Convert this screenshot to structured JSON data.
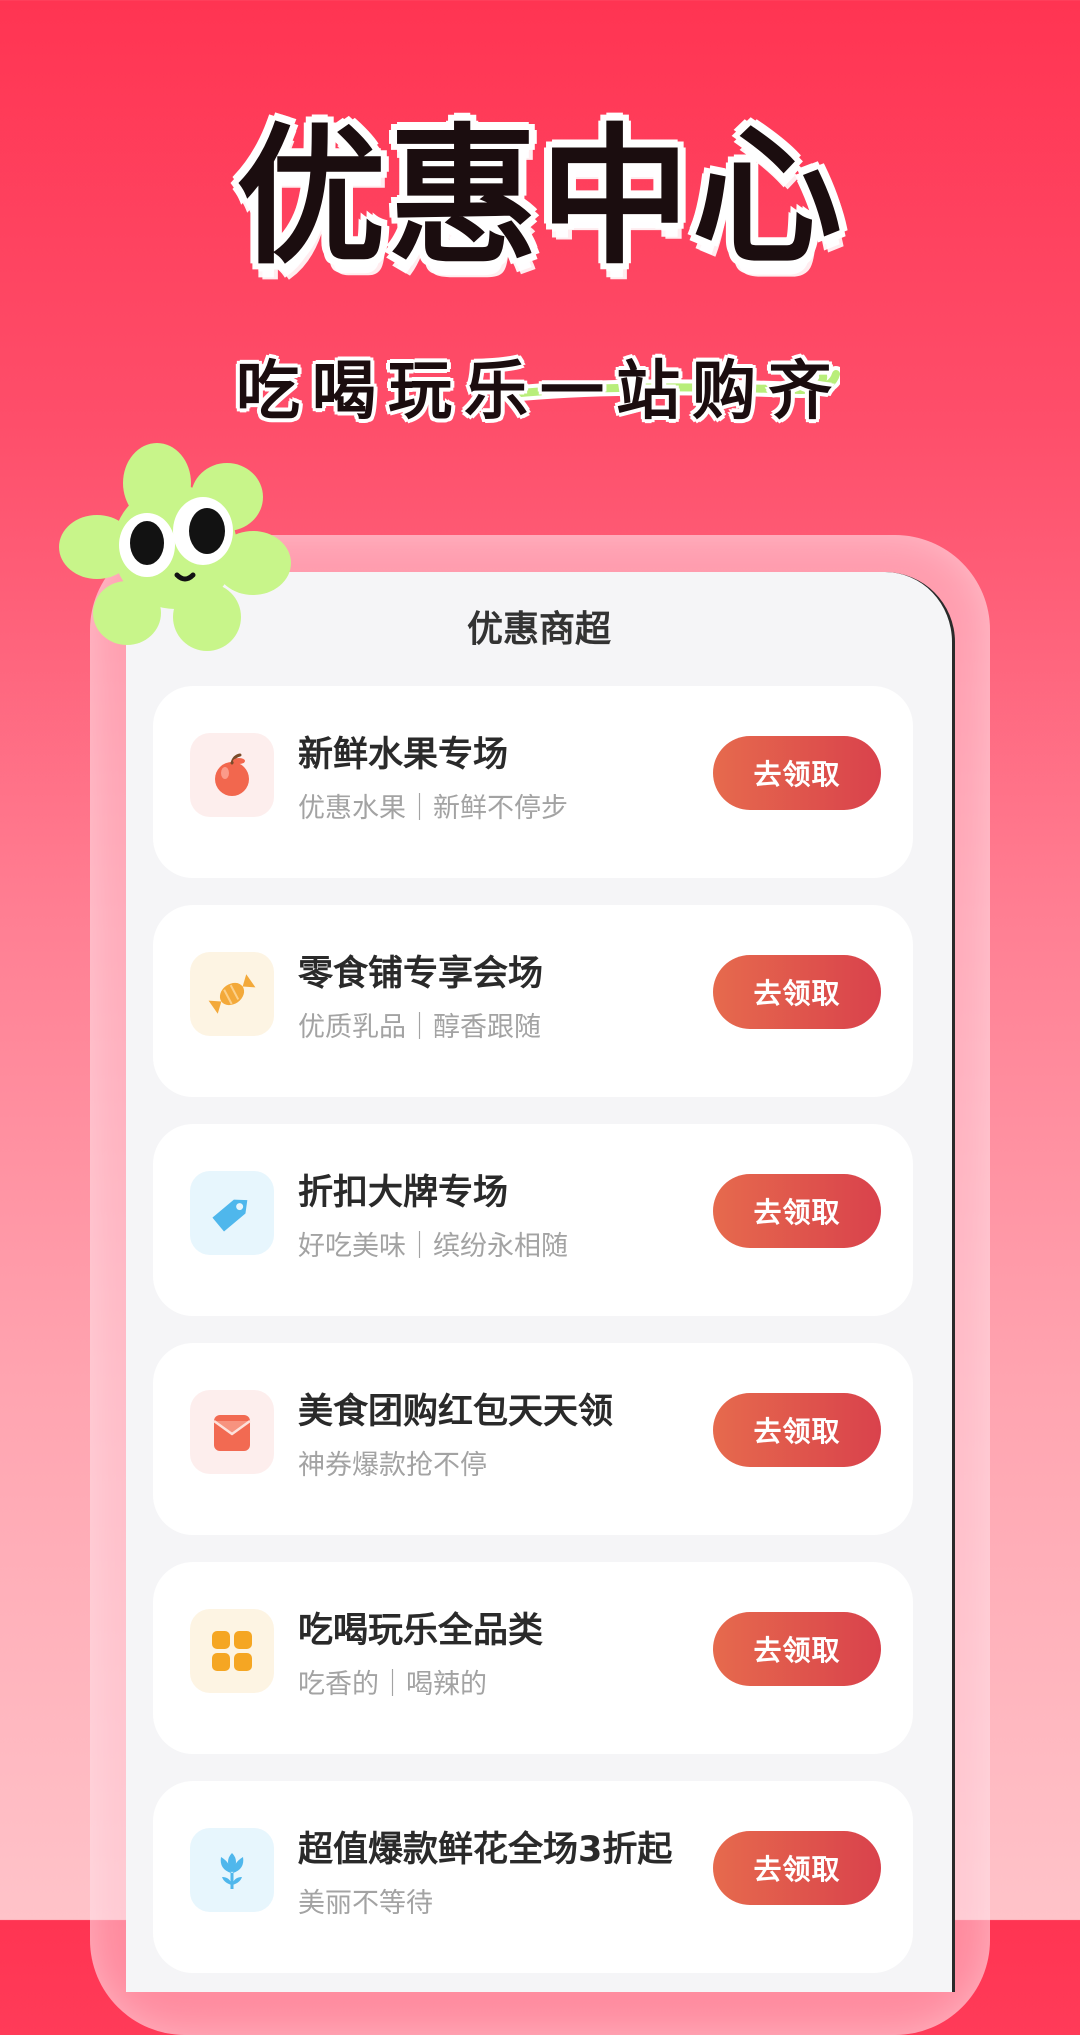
{
  "hero": {
    "title": "优惠中心",
    "subtitle": "吃喝玩乐一站购齐"
  },
  "screen": {
    "title": "优惠商超"
  },
  "cards": [
    {
      "title": "新鲜水果专场",
      "subtitle": "优惠水果｜新鲜不停步",
      "button": "去领取",
      "icon": "apple-icon",
      "icon_bg": "#fdeeed"
    },
    {
      "title": "零食铺专享会场",
      "subtitle": "优质乳品｜醇香跟随",
      "button": "去领取",
      "icon": "candy-icon",
      "icon_bg": "#fdf4e3"
    },
    {
      "title": "折扣大牌专场",
      "subtitle": "好吃美味｜缤纷永相随",
      "button": "去领取",
      "icon": "tag-icon",
      "icon_bg": "#e7f6fd"
    },
    {
      "title": "美食团购红包天天领",
      "subtitle": "神券爆款抢不停",
      "button": "去领取",
      "icon": "red-envelope-icon",
      "icon_bg": "#fdeeed"
    },
    {
      "title": "吃喝玩乐全品类",
      "subtitle": "吃香的｜喝辣的",
      "button": "去领取",
      "icon": "grid-icon",
      "icon_bg": "#fdf4e3"
    },
    {
      "title": "超值爆款鲜花全场3折起",
      "subtitle": "美丽不等待",
      "button": "去领取",
      "icon": "flower-icon",
      "icon_bg": "#e7f6fd"
    }
  ],
  "colors": {
    "background_top": "#ff3452",
    "background_bottom": "#ffc3c9",
    "button_start": "#e66a4d",
    "button_end": "#d9424c",
    "mascot": "#c8f58a"
  }
}
